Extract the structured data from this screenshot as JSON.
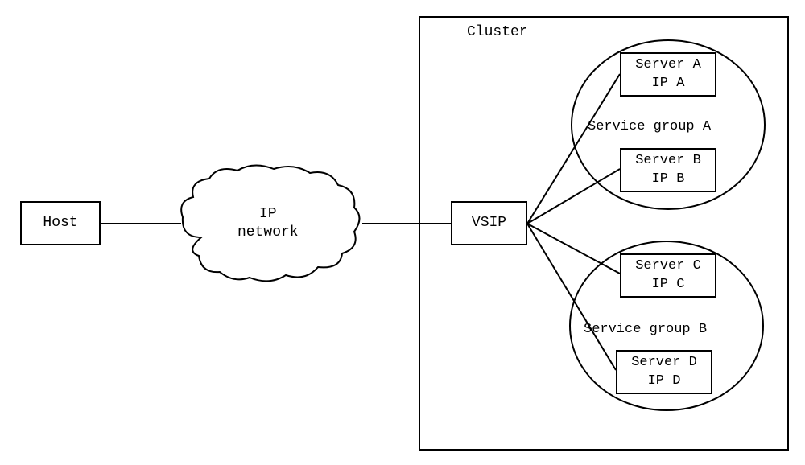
{
  "host": {
    "label": "Host"
  },
  "network": {
    "line1": "IP",
    "line2": "network"
  },
  "vsip": {
    "label": "VSIP"
  },
  "cluster": {
    "label": "Cluster"
  },
  "groupA": {
    "label": "Service group A",
    "serverA": {
      "line1": "Server A",
      "line2": "IP A"
    },
    "serverB": {
      "line1": "Server B",
      "line2": "IP B"
    }
  },
  "groupB": {
    "label": "Service group B",
    "serverC": {
      "line1": "Server C",
      "line2": "IP C"
    },
    "serverD": {
      "line1": "Server D",
      "line2": "IP D"
    }
  }
}
